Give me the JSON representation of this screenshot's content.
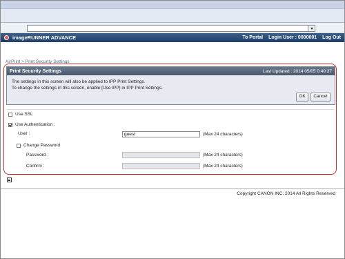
{
  "header": {
    "brand": "imageRUNNER ADVANCE",
    "to_portal": "To Portal",
    "login_user": "Login User : 0000001",
    "logout": "Log Out"
  },
  "breadcrumb": {
    "parent": "AirPrint",
    "separator": " > ",
    "current": "Print Security Settings"
  },
  "panel": {
    "title": "Print Security Settings",
    "last_updated": "Last Updated : 2014 05/05 0:40:37",
    "message_line1": "The settings in this screen will also be applied to IPP Print Settings.",
    "message_line2": "To change the settings in this screen, enable [Use IPP] in IPP Print Settings.",
    "ok_label": "OK",
    "cancel_label": "Cancel"
  },
  "form": {
    "use_ssl": {
      "label": "Use SSL",
      "checked": false
    },
    "use_authentication": {
      "label": "Use Authentication :",
      "checked": true
    },
    "user": {
      "label": "User :",
      "value": "guest",
      "hint": "(Max 24 characters)"
    },
    "change_password": {
      "label": "Change Password",
      "checked": false
    },
    "password": {
      "label": "Password :",
      "value": "",
      "hint": "(Max 24 characters)"
    },
    "confirm": {
      "label": "Confirm :",
      "value": "",
      "hint": "(Max 24 characters)"
    }
  },
  "footer": {
    "copyright": "Copyright CANON INC. 2014 All Rights Reserved"
  },
  "colors": {
    "header_bg": "#2b4d78",
    "panel_head_bg": "#5b697d",
    "highlight": "#d0312d"
  }
}
